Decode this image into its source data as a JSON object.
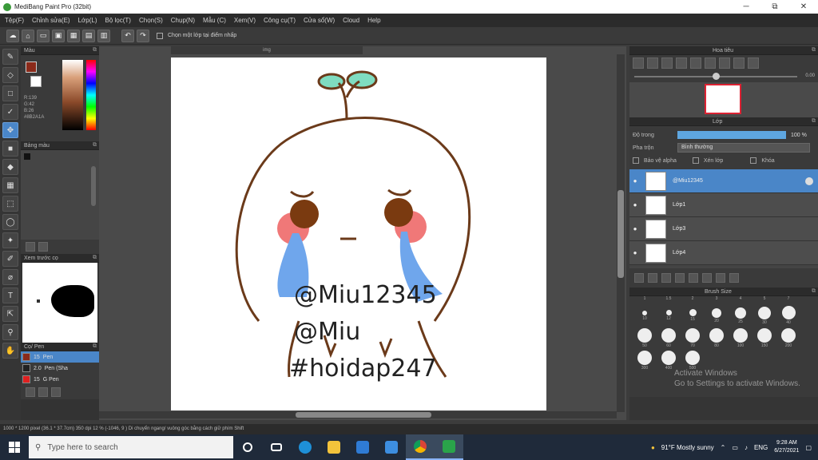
{
  "window": {
    "title": "MediBang Paint Pro (32bit)",
    "minimize": "─",
    "maximize": "⧉",
    "close": "✕"
  },
  "menu": [
    "Tệp(F)",
    "Chỉnh sửa(E)",
    "Lớp(L)",
    "Bộ lọc(T)",
    "Chọn(S)",
    "Chụp(N)",
    "Mẫu (C)",
    "Xem(V)",
    "Công cụ(T)",
    "Cửa sổ(W)",
    "Cloud",
    "Help"
  ],
  "toolbar": {
    "checkbox_label": "Chọn một lớp tại điểm nhấp"
  },
  "color_panel": {
    "title": "Màu",
    "main_color": "#8b2a1a",
    "sub_color": "#ffffff",
    "values": [
      "R:139",
      "G:42",
      "B:26",
      "#8B2A1A"
    ]
  },
  "palette_panel": {
    "title": "Bảng màu"
  },
  "brush_panel": {
    "title": "Xem trước cọ",
    "brushes": [
      {
        "size": "15",
        "name": "Pen",
        "color": "#8b2a1a",
        "selected": true
      },
      {
        "size": "2.0",
        "name": "Pen (Sha",
        "color": "#222222",
        "selected": false
      },
      {
        "size": "15",
        "name": "G Pen",
        "color": "#e02020",
        "selected": false
      }
    ],
    "list_title": "Cọ/ Pen"
  },
  "canvas": {
    "tab": "img",
    "watermarks": [
      "@Miu12345",
      "@Miu",
      "#hoidap247"
    ]
  },
  "navigator": {
    "title": "Hoa tiêu",
    "zoom": "0.00"
  },
  "layers": {
    "title": "Lớp",
    "opacity_label": "Độ trong",
    "opacity_value": "100 %",
    "blend_label": "Pha trộn",
    "blend_value": "Bình thường",
    "check_alpha": "Bảo vệ alpha",
    "check_clip": "Xén lớp",
    "check_lock": "Khóa",
    "items": [
      {
        "name": "@Miu12345",
        "selected": true
      },
      {
        "name": "Lớp1",
        "selected": false
      },
      {
        "name": "Lớp3",
        "selected": false
      },
      {
        "name": "Lớp4",
        "selected": false
      }
    ]
  },
  "brush_size": {
    "title": "Brush Size",
    "header": [
      "1",
      "1.5",
      "2",
      "3",
      "4",
      "5",
      "7"
    ],
    "sizes": [
      "10",
      "12",
      "15",
      "20",
      "25",
      "30",
      "40",
      "50",
      "60",
      "70",
      "80",
      "100",
      "150",
      "200",
      "300",
      "400",
      "500"
    ],
    "activate_line1": "Activate Windows",
    "activate_line2": "Go to Settings to activate Windows."
  },
  "status": "1000 * 1200 pixel  (36.1 * 37.7cm)  350 dpi  12 %  (-1046, 9 )  Di chuyển ngang/ vuông góc bằng cách giữ phím Shift",
  "taskbar": {
    "search_placeholder": "Type here to search",
    "weather": "91°F  Mostly sunny",
    "lang": "ENG",
    "time": "9:28 AM",
    "date": "6/27/2021"
  }
}
